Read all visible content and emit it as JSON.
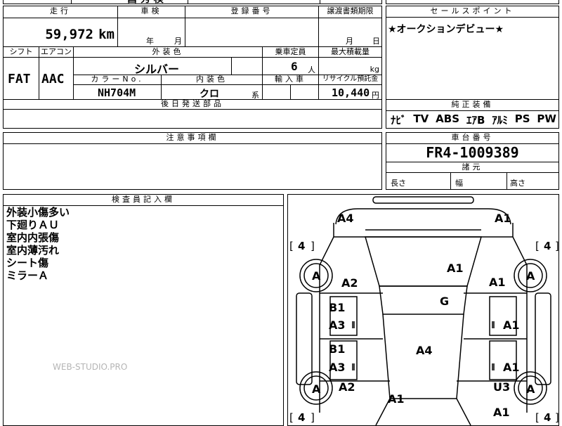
{
  "top_strip": {
    "partial_text": "昌 秀 検"
  },
  "mileage": {
    "header": "走行",
    "value": "59,972",
    "unit": "km"
  },
  "inspection": {
    "header": "車検",
    "year_label": "年",
    "month_label": "月"
  },
  "registration": {
    "header": "登録番号",
    "value": ""
  },
  "transfer_deadline": {
    "header": "譲渡書類期限",
    "month_label": "月",
    "day_label": "日"
  },
  "transmission": {
    "header": "シフト",
    "value": "FAT"
  },
  "aircon": {
    "header": "エアコン",
    "value": "AAC"
  },
  "exterior_color": {
    "header": "外装色",
    "value": "シルバー"
  },
  "color_no": {
    "header": "カラーNo.",
    "value": "NH704M"
  },
  "interior_color": {
    "header": "内装色",
    "value": "クロ",
    "suffix": "系"
  },
  "capacity": {
    "header": "乗車定員",
    "value": "6",
    "unit": "人"
  },
  "max_load": {
    "header": "最大積載量",
    "value": "",
    "unit": "kg"
  },
  "import_car": {
    "header": "輸入車",
    "value": ""
  },
  "recycle_fee": {
    "header": "リサイクル預託金",
    "value": "10,440",
    "unit": "円"
  },
  "later_parts": {
    "header": "後日発送部品"
  },
  "sales_point": {
    "header": "セールスポイント",
    "text": "★オークションデビュー★"
  },
  "equipment": {
    "header": "純正装備",
    "items": [
      "ﾅﾋﾞ",
      "TV",
      "ABS",
      "ｴｱB",
      "ｱﾙﾐ",
      "PS",
      "PW"
    ]
  },
  "notes": {
    "header": "注意事項欄"
  },
  "chassis": {
    "header": "車台番号",
    "value": "FR4-1009389"
  },
  "dimensions": {
    "header": "諸元",
    "length": "長さ",
    "width": "幅",
    "height": "高さ"
  },
  "inspector": {
    "header": "検査員記入欄",
    "lines": [
      "外装小傷多い",
      "下廻りＡＵ",
      "室内内張傷",
      "室内薄汚れ",
      "シート傷",
      "ミラーＡ"
    ]
  },
  "watermark": "WEB-STUDIO.PRO",
  "damage_map": {
    "tire_left_top": "4",
    "tire_right_top": "4",
    "tire_left_bottom": "4",
    "tire_right_bottom": "4",
    "marks": [
      "A4",
      "A1",
      "A2",
      "A1",
      "A1",
      "G",
      "B1",
      "A3",
      "A1",
      "B1",
      "A3",
      "A1",
      "A4",
      "A2",
      "U3",
      "A1",
      "A1"
    ],
    "wheel_a": "A"
  }
}
